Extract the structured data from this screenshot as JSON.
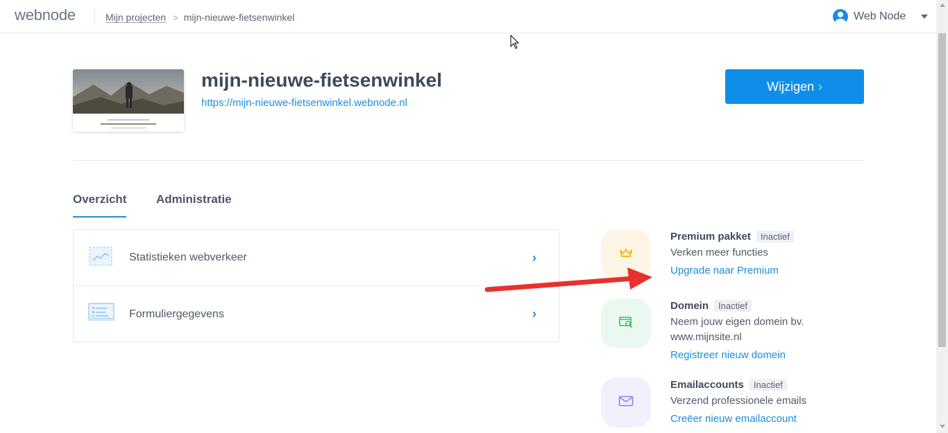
{
  "header": {
    "logo": "webnode",
    "breadcrumb": {
      "root": "Mijn projecten",
      "current": "mijn-nieuwe-fietsenwinkel"
    },
    "user_name": "Web Node"
  },
  "project": {
    "title": "mijn-nieuwe-fietsenwinkel",
    "url": "https://mijn-nieuwe-fietsenwinkel.webnode.nl",
    "edit_label": "Wijzigen"
  },
  "tabs": [
    {
      "label": "Overzicht",
      "active": true
    },
    {
      "label": "Administratie",
      "active": false
    }
  ],
  "list": [
    {
      "label": "Statistieken webverkeer",
      "icon": "stats-chart-icon"
    },
    {
      "label": "Formuliergegevens",
      "icon": "form-data-icon"
    }
  ],
  "services": [
    {
      "title": "Premium pakket",
      "status": "Inactief",
      "description": "Verken meer functies",
      "link": "Upgrade naar Premium",
      "icon": "crown-icon",
      "color": "#f5b400",
      "bg": "#fdf6e7"
    },
    {
      "title": "Domein",
      "status": "Inactief",
      "description_line1": "Neem jouw eigen domein bv.",
      "description_line2": "www.mijnsite.nl",
      "link": "Registreer nieuw domein",
      "icon": "domain-search-icon",
      "color": "#3fbb6a",
      "bg": "#eaf8ef"
    },
    {
      "title": "Emailaccounts",
      "status": "Inactief",
      "description": "Verzend professionele emails",
      "link": "Creëer nieuw emailaccount",
      "icon": "mail-icon",
      "color": "#8a7ee8",
      "bg": "#f2f0fd"
    }
  ],
  "colors": {
    "accent": "#0f8ee9",
    "link": "#1a8de0",
    "annotation_arrow": "#e8312c"
  }
}
